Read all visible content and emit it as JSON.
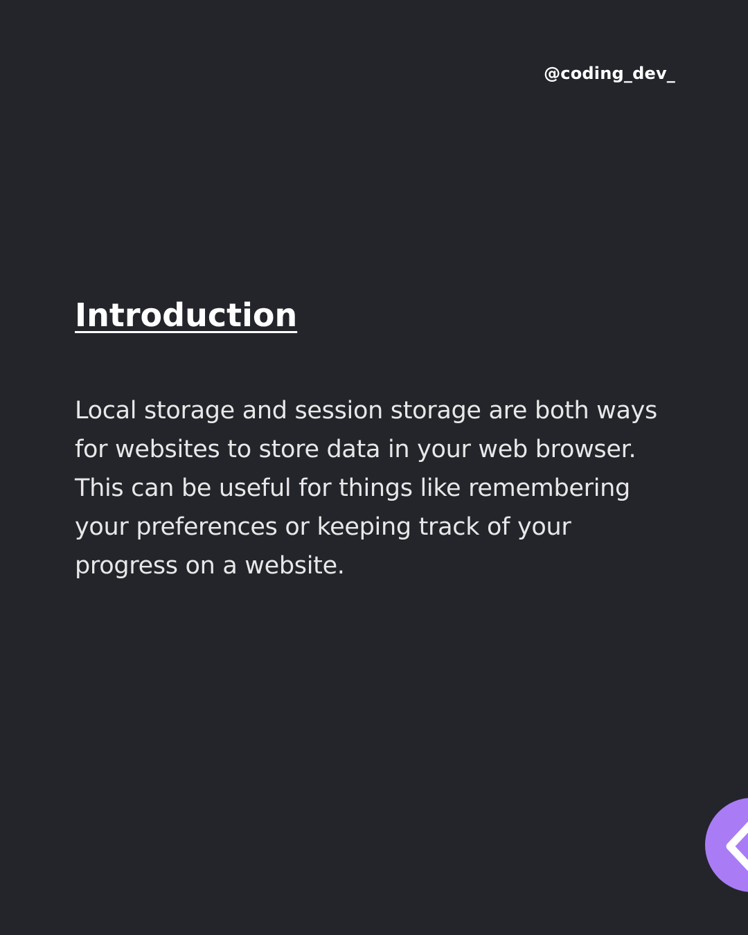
{
  "header": {
    "handle": "@coding_dev_"
  },
  "main": {
    "title": "Introduction",
    "body": "Local storage and session storage are both ways for websites to store data in your web browser. This can be useful for things like remembering your preferences or keeping track of your progress on a website."
  },
  "navigation": {
    "prev_icon": "chevron-left-icon"
  },
  "colors": {
    "background": "#24252b",
    "accent": "#a97cf6",
    "text": "#ffffff"
  }
}
